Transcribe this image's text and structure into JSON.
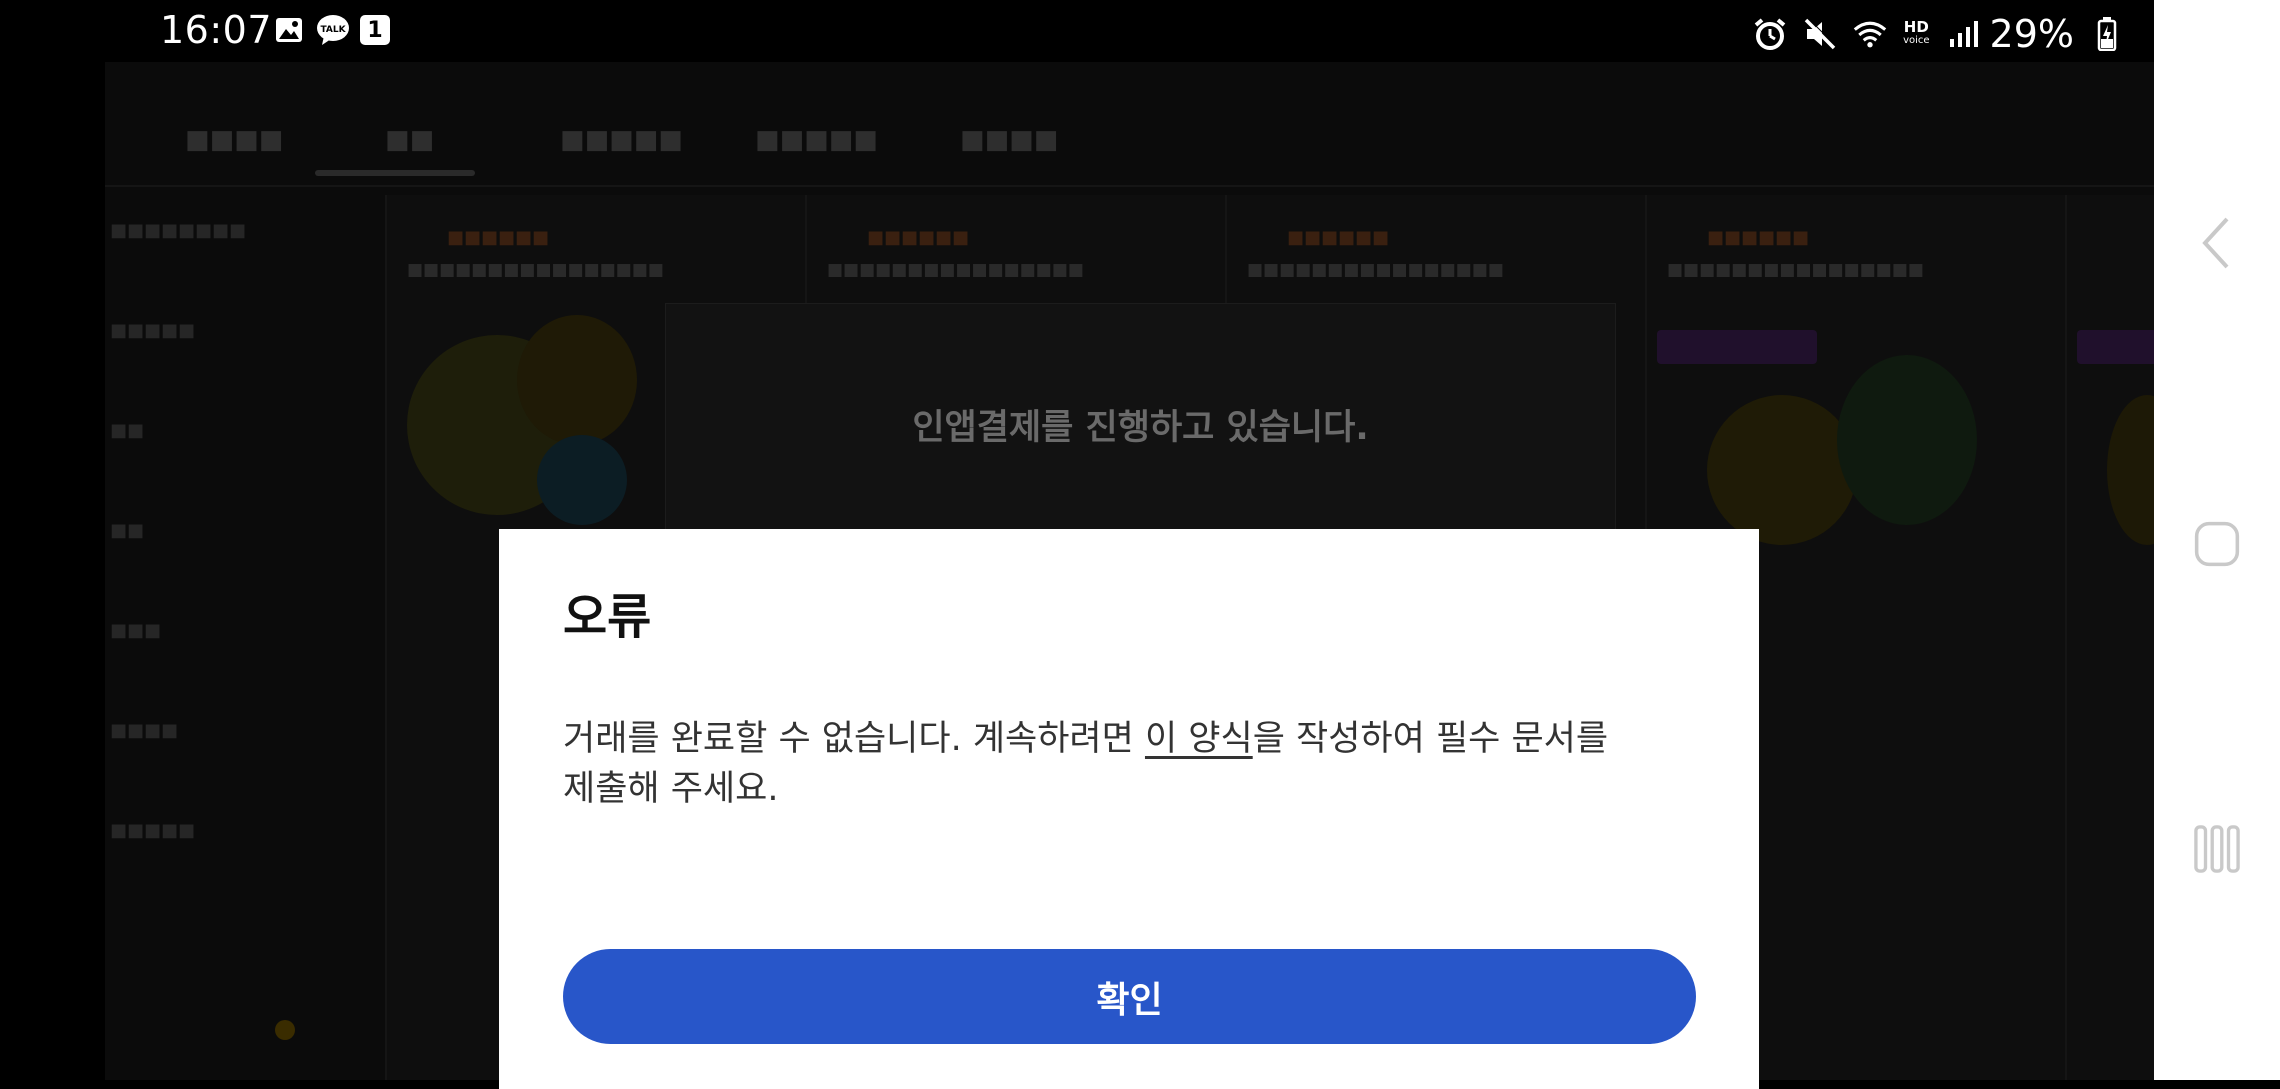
{
  "status_bar": {
    "time": "16:07",
    "notification_badge": "1",
    "hd_voice_top": "HD",
    "hd_voice_bottom": "voice",
    "battery_percent": "29%",
    "icons": [
      "gallery-icon",
      "kakaotalk-icon",
      "notification-badge-icon",
      "alarm-icon",
      "mute-icon",
      "wifi-icon",
      "hd-voice-icon",
      "signal-icon",
      "battery-charging-icon"
    ]
  },
  "processing_dialog": {
    "message": "인앱결제를 진행하고 있습니다."
  },
  "error_dialog": {
    "title": "오류",
    "message_before_link": "거래를 완료할 수 없습니다. 계속하려면 ",
    "link_text": "이 양식",
    "message_after_link": "을 작성하여 필수 문서를 제출해 주세요.",
    "confirm_label": "확인"
  },
  "nav_bar": {
    "icons": [
      "back-icon",
      "home-icon",
      "recents-icon"
    ]
  }
}
